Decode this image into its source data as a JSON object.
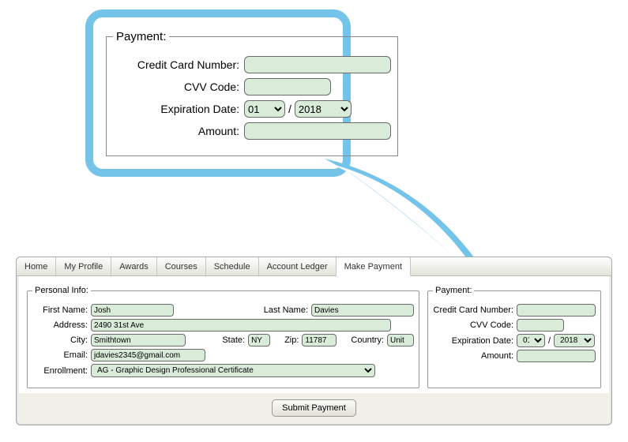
{
  "callout": {
    "legend": "Payment:",
    "cc_label": "Credit Card Number:",
    "cvv_label": "CVV Code:",
    "exp_label": "Expiration Date:",
    "amount_label": "Amount:",
    "month": "01",
    "year": "2018",
    "slash": "/"
  },
  "tabs": {
    "home": "Home",
    "profile": "My Profile",
    "awards": "Awards",
    "courses": "Courses",
    "schedule": "Schedule",
    "ledger": "Account Ledger",
    "payment": "Make Payment"
  },
  "personal": {
    "legend": "Personal Info:",
    "first_label": "First Name:",
    "first": "Josh",
    "last_label": "Last Name:",
    "last": "Davies",
    "address_label": "Address:",
    "address": "2490 31st Ave",
    "city_label": "City:",
    "city": "Smithtown",
    "state_label": "State:",
    "state": "NY",
    "zip_label": "Zip:",
    "zip": "11787",
    "country_label": "Country:",
    "country": "Unit",
    "email_label": "Email:",
    "email": "jdavies2345@gmail.com",
    "enroll_label": "Enrollment:",
    "enroll": "AG - Graphic Design Professional Certificate"
  },
  "payment": {
    "legend": "Payment:",
    "cc_label": "Credit Card Number:",
    "cvv_label": "CVV Code:",
    "exp_label": "Expiration Date:",
    "amount_label": "Amount:",
    "month": "01",
    "year": "2018",
    "slash": "/"
  },
  "submit_label": "Submit Payment"
}
